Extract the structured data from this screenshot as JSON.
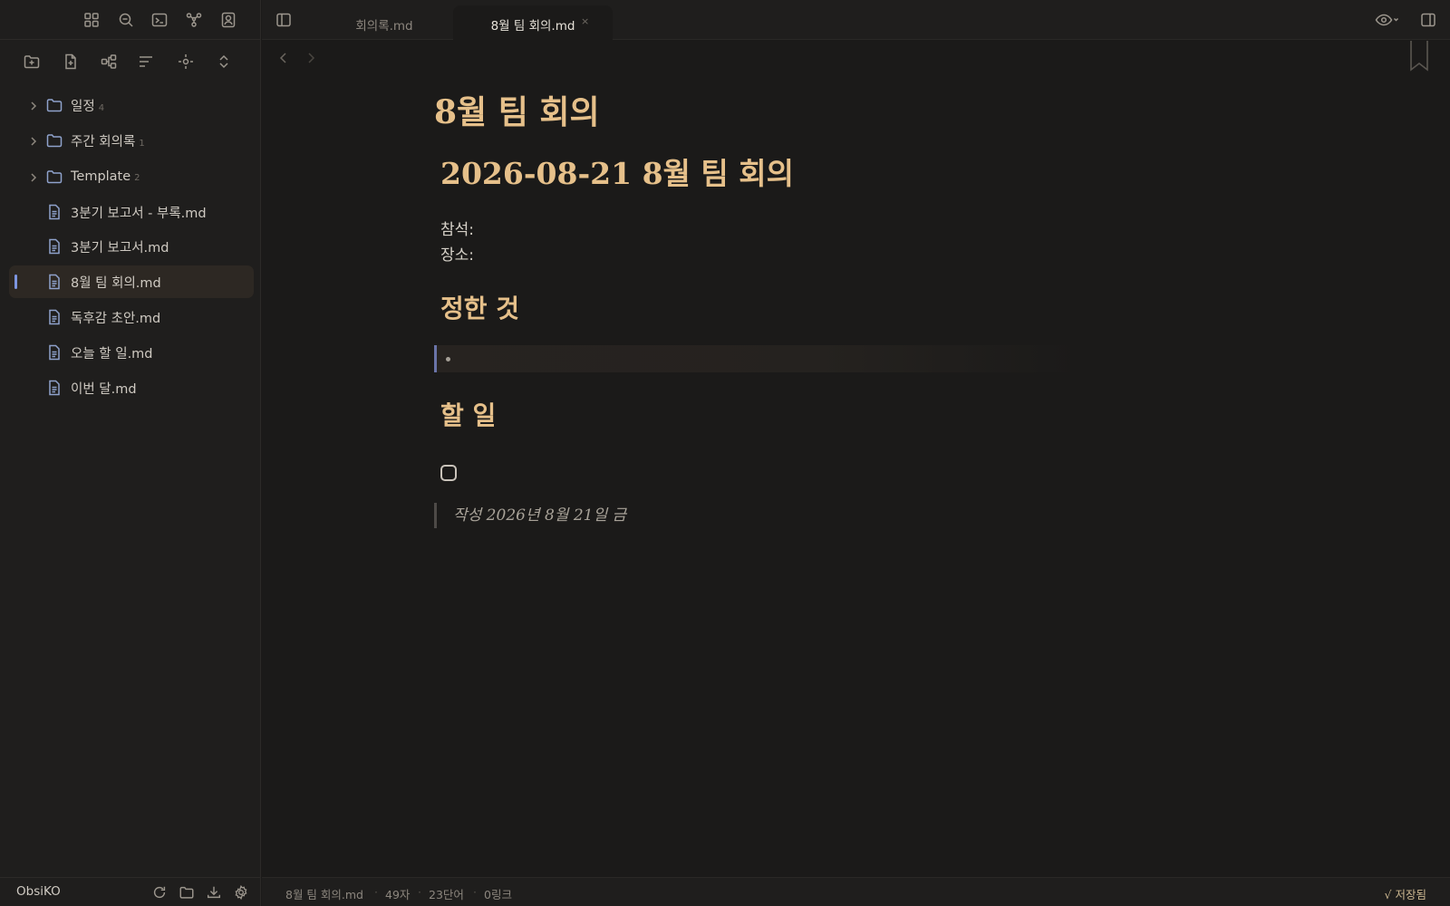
{
  "sidebar": {
    "top_icons": [
      "grid-icon",
      "search-icon",
      "terminal-icon",
      "graph-icon",
      "profile-icon"
    ],
    "tools": [
      "new-folder-icon",
      "new-note-icon",
      "graph-nodes-icon",
      "sort-icon",
      "locate-icon",
      "collapse-expand-icon"
    ],
    "items": [
      {
        "type": "folder",
        "label": "일정",
        "count": "4"
      },
      {
        "type": "folder",
        "label": "주간 회의록",
        "count": "1"
      },
      {
        "type": "folder",
        "label": "Template",
        "count": "2"
      },
      {
        "type": "file",
        "label": "3분기 보고서 - 부록.md"
      },
      {
        "type": "file",
        "label": "3분기 보고서.md"
      },
      {
        "type": "file",
        "label": "8월 팀 회의.md",
        "active": true
      },
      {
        "type": "file",
        "label": "독후감 초안.md"
      },
      {
        "type": "file",
        "label": "오늘 할 일.md"
      },
      {
        "type": "file",
        "label": "이번 달.md"
      }
    ],
    "footer": {
      "vault_name": "ObsiKO",
      "icons": [
        "refresh-icon",
        "folder-icon",
        "download-icon",
        "settings-icon"
      ]
    }
  },
  "tabs": [
    {
      "label": "회의록.md",
      "close": "×",
      "active": false
    },
    {
      "label": "8월 팀 회의.md",
      "close": "×",
      "active": true
    }
  ],
  "document": {
    "title": "8월 팀 회의",
    "heading1": "2026-08-21 8월 팀 회의",
    "attendees_label": "참석:",
    "location_label": "장소:",
    "section_decisions": "정한 것",
    "section_todo": "할 일",
    "footer_quote": "작성 2026년 8월 21일 금"
  },
  "status": {
    "filename": "8월 팀 회의.md",
    "chars": "49자",
    "words": "23단어",
    "links": "0링크",
    "saved": "√ 저장됨"
  },
  "colors": {
    "heading": "#e6c08a",
    "accent": "#7d95e0",
    "background": "#1b1a19",
    "sidebar": "#1f1e1d"
  }
}
